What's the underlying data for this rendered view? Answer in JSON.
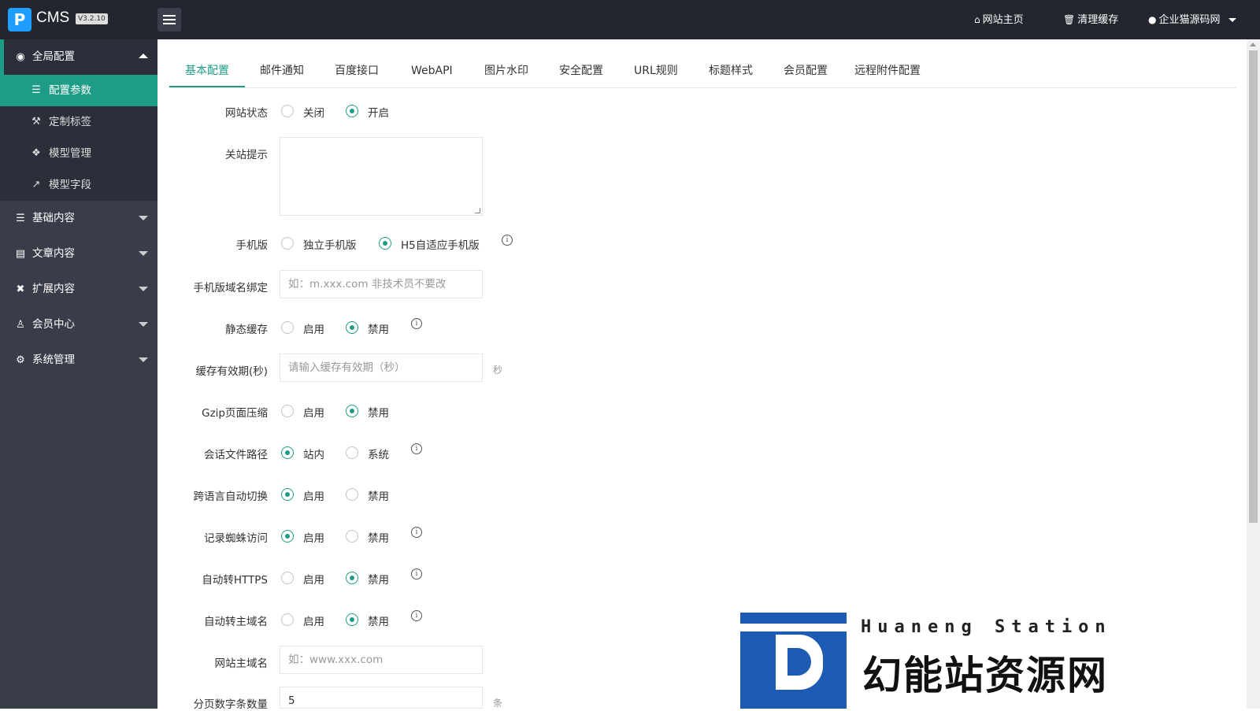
{
  "header": {
    "logo_glyph": "P",
    "brand": "CMS",
    "version": "V3.2.10",
    "nav": [
      {
        "icon": "home-icon",
        "label": "网站主页"
      },
      {
        "icon": "trash-icon",
        "label": "清理缓存"
      },
      {
        "icon": "user-icon",
        "label": "企业猫源码网"
      }
    ]
  },
  "sidebar": {
    "groups": [
      {
        "label": "全局配置",
        "icon": "globe-icon",
        "expanded": true,
        "items": [
          {
            "label": "配置参数",
            "icon": "sliders-icon",
            "active": true
          },
          {
            "label": "定制标签",
            "icon": "wrench-icon"
          },
          {
            "label": "模型管理",
            "icon": "cube-icon"
          },
          {
            "label": "模型字段",
            "icon": "external-link-icon"
          }
        ]
      },
      {
        "label": "基础内容",
        "icon": "sliders-icon"
      },
      {
        "label": "文章内容",
        "icon": "file-icon"
      },
      {
        "label": "扩展内容",
        "icon": "puzzle-icon"
      },
      {
        "label": "会员中心",
        "icon": "user-icon"
      },
      {
        "label": "系统管理",
        "icon": "gear-icon"
      }
    ]
  },
  "tabs": [
    "基本配置",
    "邮件通知",
    "百度接口",
    "WebAPI",
    "图片水印",
    "安全配置",
    "URL规则",
    "标题样式",
    "会员配置",
    "远程附件配置"
  ],
  "active_tab": "基本配置",
  "form": {
    "site_status": {
      "label": "网站状态",
      "options": [
        "关闭",
        "开启"
      ],
      "selected": "开启"
    },
    "close_tip": {
      "label": "关站提示",
      "value": ""
    },
    "mobile": {
      "label": "手机版",
      "options": [
        "独立手机版",
        "H5自适应手机版"
      ],
      "selected": "H5自适应手机版",
      "info": "i"
    },
    "mobile_domain": {
      "label": "手机版域名绑定",
      "placeholder": "如：m.xxx.com 非技术员不要改"
    },
    "static_cache": {
      "label": "静态缓存",
      "options": [
        "启用",
        "禁用"
      ],
      "selected": "禁用",
      "info": "i"
    },
    "cache_ttl": {
      "label": "缓存有效期(秒)",
      "placeholder": "请输入缓存有效期（秒）",
      "unit": "秒"
    },
    "gzip": {
      "label": "Gzip页面压缩",
      "options": [
        "启用",
        "禁用"
      ],
      "selected": "禁用"
    },
    "session_path": {
      "label": "会话文件路径",
      "options": [
        "站内",
        "系统"
      ],
      "selected": "站内",
      "info": "i"
    },
    "lang_switch": {
      "label": "跨语言自动切换",
      "options": [
        "启用",
        "禁用"
      ],
      "selected": "启用"
    },
    "spider_log": {
      "label": "记录蜘蛛访问",
      "options": [
        "启用",
        "禁用"
      ],
      "selected": "启用",
      "info": "i"
    },
    "auto_https": {
      "label": "自动转HTTPS",
      "options": [
        "启用",
        "禁用"
      ],
      "selected": "禁用",
      "info": "i"
    },
    "auto_main_domain": {
      "label": "自动转主域名",
      "options": [
        "启用",
        "禁用"
      ],
      "selected": "禁用",
      "info": "i"
    },
    "main_domain": {
      "label": "网站主域名",
      "placeholder": "如：www.xxx.com"
    },
    "page_count": {
      "label": "分页数字条数量",
      "value": "5",
      "unit": "条"
    }
  },
  "watermark": {
    "en": "Huaneng Station",
    "cn": "幻能站资源网"
  },
  "colors": {
    "accent": "#1f9c86",
    "topbar": "#23262e",
    "sidebar": "#393d49",
    "sidebar_sub": "#2b2f3a"
  }
}
